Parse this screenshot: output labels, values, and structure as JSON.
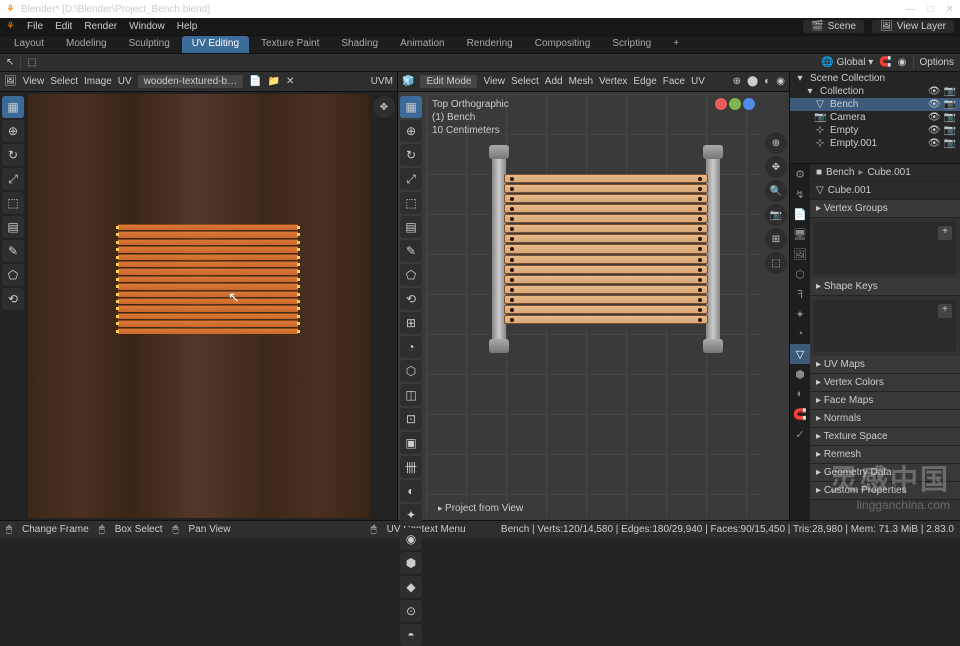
{
  "title": "Blender* [D:\\Blender\\Project_Bench.blend]",
  "window_controls": [
    "—",
    "□",
    "✕"
  ],
  "menu": [
    "File",
    "Edit",
    "Render",
    "Window",
    "Help"
  ],
  "scene_field": "Scene",
  "viewlayer_field": "View Layer",
  "workspaces": [
    "Layout",
    "Modeling",
    "Sculpting",
    "UV Editing",
    "Texture Paint",
    "Shading",
    "Animation",
    "Rendering",
    "Compositing",
    "Scripting",
    "+"
  ],
  "workspace_active": "UV Editing",
  "top_toolbar": {
    "orientation": "Global",
    "options": "Options"
  },
  "uv_header": {
    "menus": [
      "View",
      "Select",
      "Image",
      "UV"
    ],
    "image_name": "wooden-textured-b…",
    "mode": "UVM"
  },
  "uv_tools": [
    "▦",
    "⊕",
    "↻",
    "⤢",
    "⬚",
    "▤",
    "✎",
    "⬠",
    "⟲"
  ],
  "uv_right": [
    "✥"
  ],
  "v3d_header": {
    "mode": "Edit Mode",
    "menus": [
      "View",
      "Select",
      "Add",
      "Mesh",
      "Vertex",
      "Edge",
      "Face",
      "UV"
    ]
  },
  "v3d_overlay": {
    "l1": "Top Orthographic",
    "l2": "(1) Bench",
    "l3": "10 Centimeters"
  },
  "v3d_tools": [
    "▦",
    "⊕",
    "↻",
    "⤢",
    "⬚",
    "▤",
    "✎",
    "⬠",
    "⟲",
    "⊞",
    "◔",
    "⬡",
    "◫",
    "⊡",
    "▣",
    "卌",
    "◐",
    "✦",
    "◉",
    "⬢",
    "◆",
    "⊙",
    "◓"
  ],
  "v3d_right": [
    "⊕",
    "✥",
    "🔍",
    "📷",
    "⊞",
    "⬚"
  ],
  "gizmo_colors": [
    "#e85d5d",
    "#7fb84f",
    "#4f8be8"
  ],
  "project_btn": "Project from View",
  "outliner": {
    "root": "Scene Collection",
    "items": [
      {
        "icon": "▾",
        "name": "Collection",
        "type": "collection"
      },
      {
        "icon": "▽",
        "name": "Bench",
        "sel": true,
        "type": "mesh"
      },
      {
        "icon": "📷",
        "name": "Camera",
        "type": "camera"
      },
      {
        "icon": "⊹",
        "name": "Empty",
        "type": "empty"
      },
      {
        "icon": "⊹",
        "name": "Empty.001",
        "type": "empty"
      }
    ]
  },
  "props": {
    "breadcrumb": [
      "■",
      "Bench",
      "▸",
      "Cube.001"
    ],
    "name_field": "Cube.001",
    "tabs": [
      "⚙",
      "↯",
      "📄",
      "🖥",
      "🖼",
      "⬡",
      "ꟻ",
      "✦",
      "◔",
      "▽",
      "⬢",
      "◐",
      "🧲",
      "✓"
    ],
    "tab_active": 9,
    "sections": [
      "Vertex Groups",
      "Shape Keys",
      "UV Maps",
      "Vertex Colors",
      "Face Maps",
      "Normals",
      "Texture Space",
      "Remesh",
      "Geometry Data",
      "Custom Properties"
    ]
  },
  "status": {
    "left": [
      "Change Frame",
      "Box Select",
      "Pan View"
    ],
    "mid": "UV Context Menu",
    "right": "Bench | Verts:120/14,580 | Edges:180/29,940 | Faces:90/15,450 | Tris:28,980 | Mem: 71.3 MiB | 2.83.0"
  },
  "watermark": {
    "big": "灵感中国",
    "small": "lingganchina.com"
  }
}
